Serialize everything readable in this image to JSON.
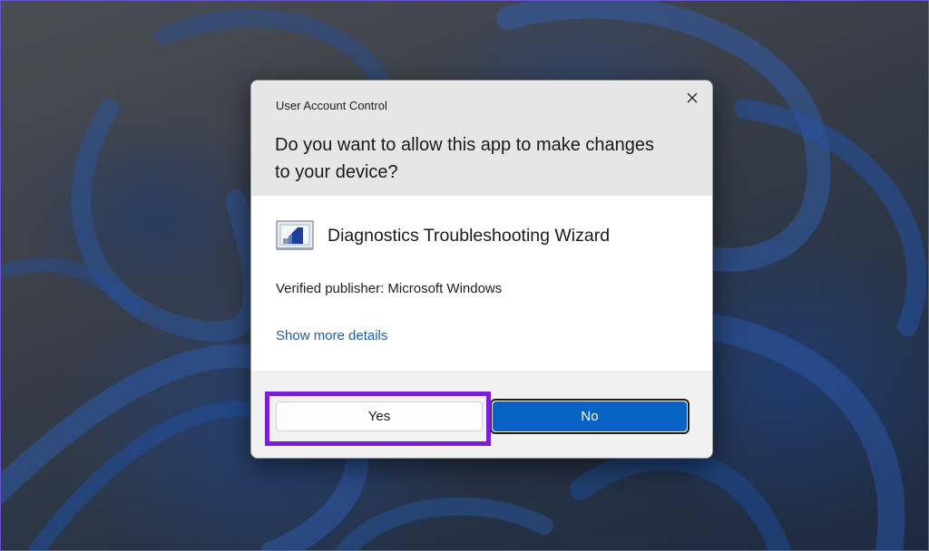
{
  "dialog": {
    "title": "User Account Control",
    "question": "Do you want to allow this app to make changes to your device?",
    "app_name": "Diagnostics Troubleshooting Wizard",
    "app_icon": "diagnostics-app-icon",
    "publisher": "Verified publisher: Microsoft Windows",
    "details_link": "Show more details",
    "close_icon": "close-icon"
  },
  "buttons": {
    "yes_label": "Yes",
    "no_label": "No"
  },
  "colors": {
    "accent": "#0863c4",
    "link": "#1c5fb0",
    "highlight": "#7a1fd6"
  }
}
